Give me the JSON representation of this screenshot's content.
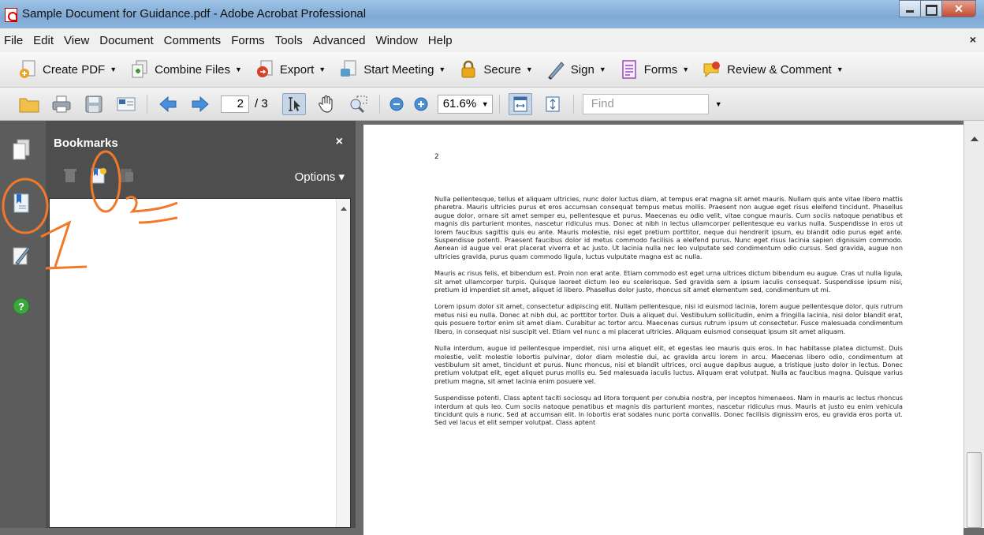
{
  "window": {
    "title": "Sample Document for Guidance.pdf - Adobe Acrobat Professional",
    "close_glyph": "✕",
    "doc_close_glyph": "×"
  },
  "menu": [
    "File",
    "Edit",
    "View",
    "Document",
    "Comments",
    "Forms",
    "Tools",
    "Advanced",
    "Window",
    "Help"
  ],
  "tasks": [
    {
      "label": "Create PDF",
      "icon": "create-pdf-icon"
    },
    {
      "label": "Combine Files",
      "icon": "combine-files-icon"
    },
    {
      "label": "Export",
      "icon": "export-icon"
    },
    {
      "label": "Start Meeting",
      "icon": "start-meeting-icon"
    },
    {
      "label": "Secure",
      "icon": "lock-icon"
    },
    {
      "label": "Sign",
      "icon": "pen-icon"
    },
    {
      "label": "Forms",
      "icon": "forms-icon"
    },
    {
      "label": "Review & Comment",
      "icon": "review-comment-icon"
    }
  ],
  "dropdown_glyph": "▼",
  "nav": {
    "page_current": "2",
    "page_total": "/ 3",
    "zoom": "61.6%",
    "find_placeholder": "Find"
  },
  "bookmarks": {
    "title": "Bookmarks",
    "close": "×",
    "options": "Options ▾"
  },
  "annotations": {
    "label_1": "1",
    "label_2": "2",
    "color": "#f07a2a"
  },
  "document": {
    "page_number": "2",
    "paragraphs": [
      "Nulla pellentesque, tellus et aliquam ultricies, nunc dolor luctus diam, at tempus erat magna sit amet mauris. Nullam quis ante vitae libero mattis pharetra. Mauris ultricies purus et eros accumsan consequat tempus metus mollis. Praesent non augue eget risus eleifend tincidunt. Phasellus augue dolor, ornare sit amet semper eu, pellentesque et purus. Maecenas eu odio velit, vitae congue mauris. Cum sociis natoque penatibus et magnis dis parturient montes, nascetur ridiculus mus. Donec at nibh in lectus ullamcorper pellentesque eu varius nulla. Suspendisse in eros ut lorem faucibus sagittis quis eu ante. Mauris molestie, nisi eget pretium porttitor, neque dui hendrerit ipsum, eu blandit odio purus eget ante. Suspendisse potenti. Praesent faucibus dolor id metus commodo facilisis a eleifend purus. Nunc eget risus lacinia sapien dignissim commodo. Aenean id augue vel erat placerat viverra et ac justo. Ut lacinia nulla nec leo vulputate sed condimentum odio cursus. Sed gravida, augue non ultricies gravida, purus quam commodo ligula, luctus vulputate magna est ac nulla.",
      "Mauris ac risus felis, et bibendum est. Proin non erat ante. Etiam commodo est eget urna ultrices dictum bibendum eu augue. Cras ut nulla ligula, sit amet ullamcorper turpis. Quisque laoreet dictum leo eu scelerisque. Sed gravida sem a ipsum iaculis consequat. Suspendisse ipsum nisi, pretium id imperdiet sit amet, aliquet id libero. Phasellus dolor justo, rhoncus sit amet elementum sed, condimentum ut mi.",
      "Lorem ipsum dolor sit amet, consectetur adipiscing elit. Nullam pellentesque, nisi id euismod lacinia, lorem augue pellentesque dolor, quis rutrum metus nisi eu nulla. Donec at nibh dui, ac porttitor tortor. Duis a aliquet dui. Vestibulum sollicitudin, enim a fringilla lacinia, nisi dolor blandit erat, quis posuere tortor enim sit amet diam. Curabitur ac tortor arcu. Maecenas cursus rutrum ipsum ut consectetur. Fusce malesuada condimentum libero, in consequat nisi suscipit vel. Etiam vel nunc a mi placerat ultricies. Aliquam euismod consequat ipsum sit amet aliquam.",
      "Nulla interdum, augue id pellentesque imperdiet, nisi urna aliquet elit, et egestas leo mauris quis eros. In hac habitasse platea dictumst. Duis molestie, velit molestie lobortis pulvinar, dolor diam molestie dui, ac gravida arcu lorem in arcu. Maecenas libero odio, condimentum at vestibulum sit amet, tincidunt et purus. Nunc rhoncus, nisi et blandit ultrices, orci augue dapibus augue, a tristique justo dolor in lectus. Donec pretium volutpat elit, eget aliquet purus mollis eu. Sed malesuada iaculis luctus. Aliquam erat volutpat. Nulla ac faucibus magna. Quisque varius pretium magna, sit amet lacinia enim posuere vel.",
      "Suspendisse potenti. Class aptent taciti sociosqu ad litora torquent per conubia nostra, per inceptos himenaeos. Nam in mauris ac lectus rhoncus interdum at quis leo. Cum sociis natoque penatibus et magnis dis parturient montes, nascetur ridiculus mus. Mauris at justo eu enim vehicula tincidunt quis a nunc. Sed at accumsan elit. In lobortis erat sodales nunc porta convallis. Donec facilisis dignissim eros, eu gravida eros porta ut. Sed vel lacus et elit semper volutpat. Class aptent"
    ]
  }
}
